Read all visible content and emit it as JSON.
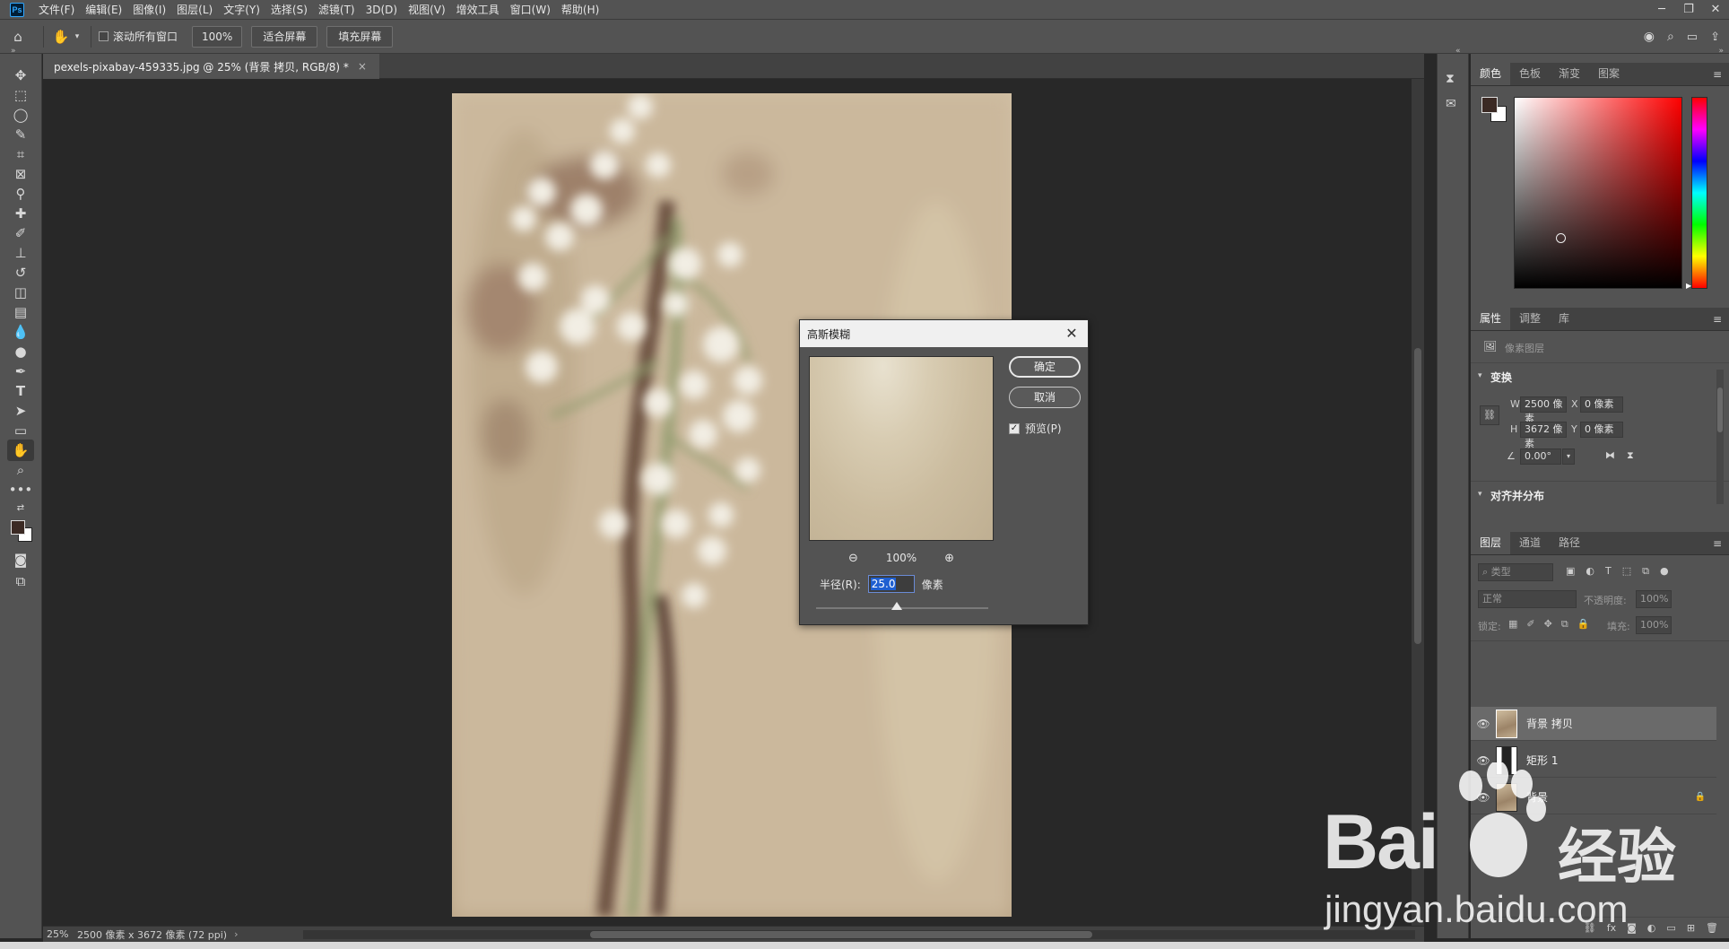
{
  "menubar": {
    "logo": "Ps",
    "items": [
      "文件(F)",
      "编辑(E)",
      "图像(I)",
      "图层(L)",
      "文字(Y)",
      "选择(S)",
      "滤镜(T)",
      "3D(D)",
      "视图(V)",
      "增效工具",
      "窗口(W)",
      "帮助(H)"
    ],
    "window_controls": [
      "─",
      "❐",
      "✕"
    ]
  },
  "optbar": {
    "scroll_all_label": "滚动所有窗口",
    "zoom_value": "100%",
    "fit_screen": "适合屏幕",
    "fill_screen": "填充屏幕"
  },
  "document": {
    "tab_title": "pexels-pixabay-459335.jpg @ 25% (背景 拷贝, RGB/8) *",
    "tab_close": "×"
  },
  "statusbar": {
    "zoom": "25%",
    "info": "2500 像素 x 3672 像素 (72 ppi)"
  },
  "color_panel": {
    "tabs": [
      "颜色",
      "色板",
      "渐变",
      "图案"
    ],
    "active_tab": 0,
    "foreground": "#3b2a24",
    "background": "#ffffff",
    "hue_color": "#ff0000"
  },
  "properties_panel": {
    "tabs": [
      "属性",
      "调整",
      "库"
    ],
    "active_tab": 0,
    "pixel_layer_label": "像素图层",
    "transform_title": "变换",
    "w_label": "W",
    "w_value": "2500 像素",
    "h_label": "H",
    "h_value": "3672 像素",
    "x_label": "X",
    "x_value": "0 像素",
    "y_label": "Y",
    "y_value": "0 像素",
    "angle_value": "0.00°",
    "align_title": "对齐并分布"
  },
  "layers_panel": {
    "tabs": [
      "图层",
      "通道",
      "路径"
    ],
    "active_tab": 0,
    "filter_placeholder": "类型",
    "blend_mode": "正常",
    "opacity_label": "不透明度:",
    "opacity_value": "100%",
    "lock_label": "锁定:",
    "fill_label": "填充:",
    "fill_value": "100%",
    "layers": [
      {
        "name": "背景 拷贝",
        "selected": true,
        "locked": false
      },
      {
        "name": "矩形 1",
        "selected": false,
        "locked": false
      },
      {
        "name": "背景",
        "selected": false,
        "locked": true
      }
    ]
  },
  "dialog": {
    "title": "高斯模糊",
    "ok": "确定",
    "cancel": "取消",
    "preview_label": "预览(P)",
    "preview_checked": true,
    "zoom_value": "100%",
    "radius_label": "半径(R):",
    "radius_value": "25.0",
    "radius_unit": "像素"
  },
  "watermark": {
    "brand": "Bai",
    "brand_cn": "经验",
    "url": "jingyan.baidu.com"
  }
}
